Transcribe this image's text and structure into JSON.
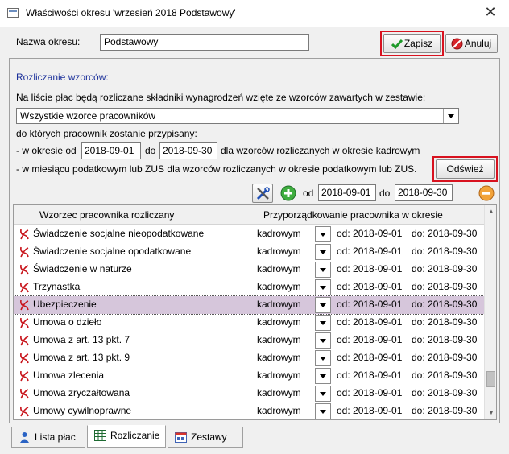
{
  "window": {
    "title": "Właściwości okresu 'wrzesień 2018 Podstawowy'",
    "close": "✕"
  },
  "period": {
    "label": "Nazwa okresu:",
    "value": "Podstawowy"
  },
  "buttons": {
    "save": "Zapisz",
    "cancel": "Anuluj",
    "refresh": "Odśwież"
  },
  "group": {
    "title": "Rozliczanie wzorców:",
    "intro": "Na liście płac będą rozliczane składniki wynagrodzeń wzięte ze wzorców zawartych w zestawie:",
    "set_value": "Wszystkie wzorce pracowników",
    "assign_text": "do których pracownik zostanie przypisany:",
    "line1_prefix": "- w okresie od",
    "line1_from": "2018-09-01",
    "line1_mid": "do",
    "line1_to": "2018-09-30",
    "line1_suffix": "dla wzorców rozliczanych w okresie kadrowym",
    "line2": "- w miesiącu podatkowym lub ZUS dla wzorców rozliczanych w okresie podatkowym lub ZUS."
  },
  "toolbar": {
    "od": "od",
    "from": "2018-09-01",
    "do": "do",
    "to": "2018-09-30"
  },
  "grid": {
    "col1": "Wzorzec pracownika rozliczany",
    "col2": "Przyporządkowanie pracownika w okresie",
    "rows": [
      {
        "name": "Świadczenie socjalne nieopodatkowane",
        "type": "kadrowym",
        "from": "od: 2018-09-01",
        "to": "do: 2018-09-30"
      },
      {
        "name": "Świadczenie socjalne opodatkowane",
        "type": "kadrowym",
        "from": "od: 2018-09-01",
        "to": "do: 2018-09-30"
      },
      {
        "name": "Świadczenie w naturze",
        "type": "kadrowym",
        "from": "od: 2018-09-01",
        "to": "do: 2018-09-30"
      },
      {
        "name": "Trzynastka",
        "type": "kadrowym",
        "from": "od: 2018-09-01",
        "to": "do: 2018-09-30"
      },
      {
        "name": "Ubezpieczenie",
        "type": "kadrowym",
        "from": "od: 2018-09-01",
        "to": "do: 2018-09-30"
      },
      {
        "name": "Umowa o dzieło",
        "type": "kadrowym",
        "from": "od: 2018-09-01",
        "to": "do: 2018-09-30"
      },
      {
        "name": "Umowa z art. 13 pkt. 7",
        "type": "kadrowym",
        "from": "od: 2018-09-01",
        "to": "do: 2018-09-30"
      },
      {
        "name": "Umowa z art. 13 pkt. 9",
        "type": "kadrowym",
        "from": "od: 2018-09-01",
        "to": "do: 2018-09-30"
      },
      {
        "name": "Umowa zlecenia",
        "type": "kadrowym",
        "from": "od: 2018-09-01",
        "to": "do: 2018-09-30"
      },
      {
        "name": "Umowa zryczałtowana",
        "type": "kadrowym",
        "from": "od: 2018-09-01",
        "to": "do: 2018-09-30"
      },
      {
        "name": "Umowy cywilnoprawne",
        "type": "kadrowym",
        "from": "od: 2018-09-01",
        "to": "do: 2018-09-30"
      }
    ]
  },
  "tabs": [
    {
      "label": "Lista płac",
      "icon": "user-icon"
    },
    {
      "label": "Rozliczanie",
      "icon": "spreadsheet-icon"
    },
    {
      "label": "Zestawy",
      "icon": "calendar-icon"
    }
  ],
  "colors": {
    "selected_row": "#d6c6db",
    "highlight_frame": "#d8121f",
    "group_title": "#1a2f9a"
  }
}
